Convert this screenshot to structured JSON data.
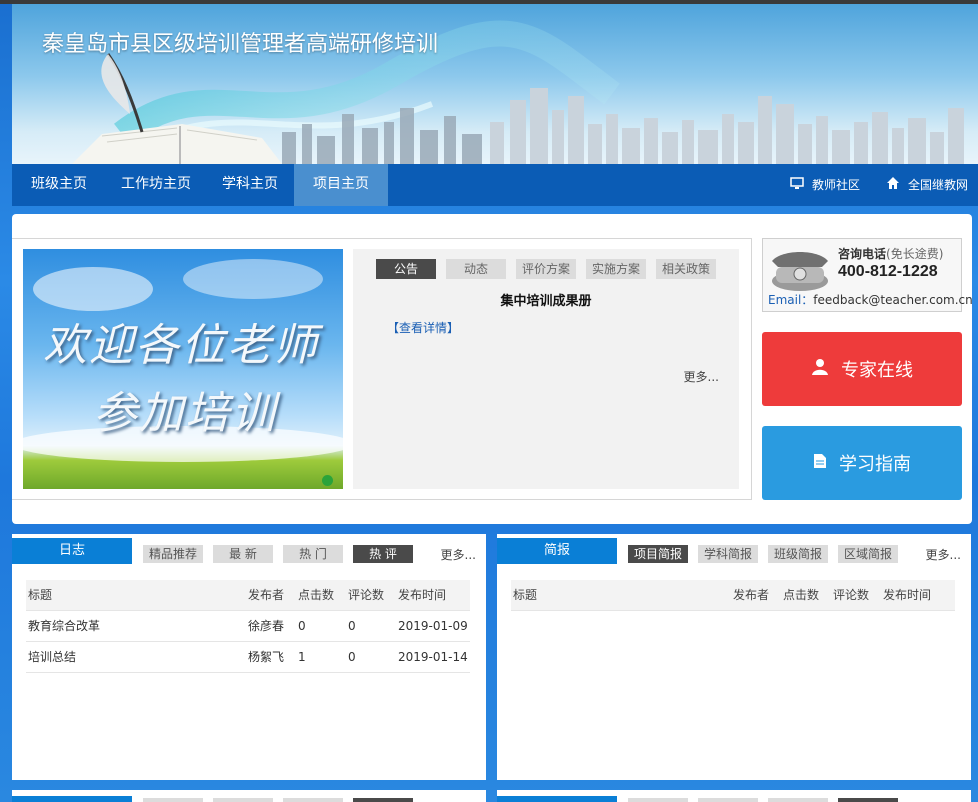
{
  "banner": {
    "title": "秦皇岛市县区级培训管理者高端研修培训"
  },
  "nav": {
    "items": [
      {
        "label": "班级主页",
        "active": false
      },
      {
        "label": "工作坊主页",
        "active": false
      },
      {
        "label": "学科主页",
        "active": false
      },
      {
        "label": "项目主页",
        "active": true
      }
    ],
    "right": [
      {
        "label": "教师社区",
        "icon": "monitor-icon"
      },
      {
        "label": "全国继教网",
        "icon": "home-icon"
      }
    ]
  },
  "carousel": {
    "line1": "欢迎各位老师",
    "line2": "参加培训"
  },
  "notice": {
    "tabs": [
      "公告",
      "动态",
      "评价方案",
      "实施方案",
      "相关政策"
    ],
    "active_tab": "公告",
    "title": "集中培训成果册",
    "link": "【查看详情】",
    "more": "更多..."
  },
  "contact": {
    "label": "咨询电话",
    "label_note": "(免长途费)",
    "phone": "400-812-1228",
    "email_label": "Email：",
    "email": "feedback@teacher.com.cn"
  },
  "buttons": {
    "expert": "专家在线",
    "guide": "学习指南",
    "expert_color": "#ee3b3b",
    "guide_color": "#2a9be0"
  },
  "journal": {
    "title": "日志",
    "tabs": [
      "精品推荐",
      "最 新",
      "热 门",
      "热 评"
    ],
    "active_tab": "热 评",
    "more": "更多...",
    "columns": [
      "标题",
      "发布者",
      "点击数",
      "评论数",
      "发布时间"
    ],
    "rows": [
      [
        "教育综合改革",
        "徐彦春",
        "0",
        "0",
        "2019-01-09"
      ],
      [
        "培训总结",
        "杨絮飞",
        "1",
        "0",
        "2019-01-14"
      ]
    ]
  },
  "briefing": {
    "title": "简报",
    "tabs": [
      "项目简报",
      "学科简报",
      "班级简报",
      "区域简报"
    ],
    "active_tab": "项目简报",
    "more": "更多...",
    "columns": [
      "标题",
      "发布者",
      "点击数",
      "评论数",
      "发布时间"
    ],
    "rows": []
  }
}
